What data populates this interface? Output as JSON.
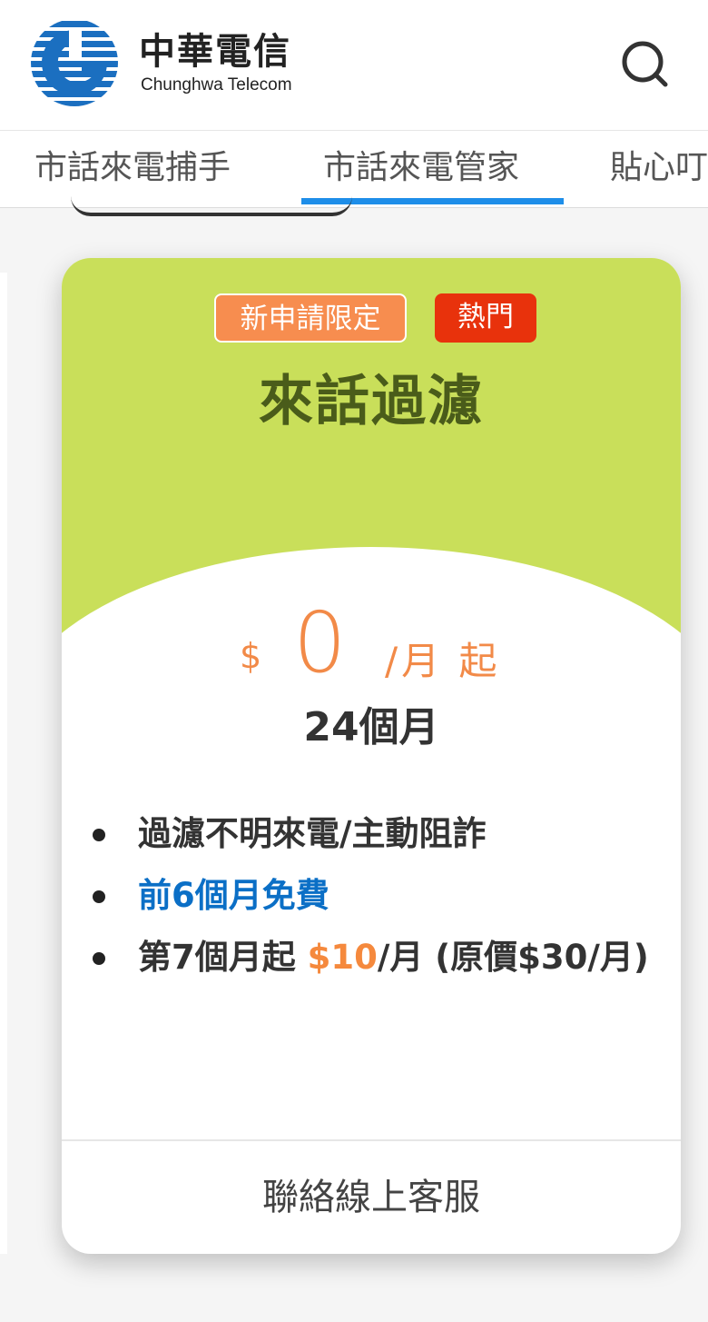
{
  "brand": {
    "name_cn": "中華電信",
    "name_en": "Chunghwa Telecom"
  },
  "tabs": [
    {
      "label": "市話來電捕手",
      "active": false
    },
    {
      "label": "市話來電管家",
      "active": true
    },
    {
      "label": "貼心叮嚀",
      "active": false
    }
  ],
  "card": {
    "badges": [
      "新申請限定",
      "熱門"
    ],
    "title": "來話過濾",
    "price": {
      "currency": "$",
      "amount": "0",
      "unit": "/月 起"
    },
    "term": "24個月",
    "features": [
      {
        "text": "過濾不明來電/主動阻詐"
      },
      {
        "text": "前6個月免費"
      },
      {
        "prefix": "第7個月起 ",
        "highlight": "$10",
        "suffix": "/月 (原價$30/月)"
      }
    ],
    "contact_label": "聯絡線上客服"
  },
  "colors": {
    "accent_blue": "#1e8ee9",
    "card_green": "#c9df5a",
    "title_green": "#4a5c1a",
    "price_orange": "#f28a48",
    "badge_orange": "#f78d4f",
    "badge_red": "#e8320c",
    "feature_blue": "#0b6fc6"
  },
  "icons": {
    "logo": "chunghwa-logo-icon",
    "search": "search-icon"
  }
}
